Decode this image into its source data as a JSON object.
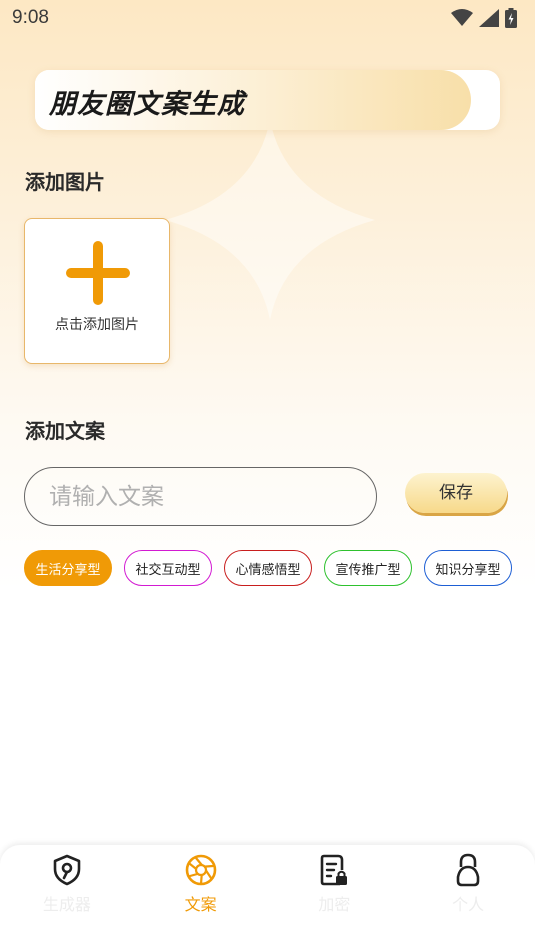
{
  "status_bar": {
    "time": "9:08"
  },
  "header": {
    "title": "朋友圈文案生成"
  },
  "image_section": {
    "title": "添加图片",
    "add_label": "点击添加图片"
  },
  "copy_section": {
    "title": "添加文案",
    "input_placeholder": "请输入文案",
    "input_value": "",
    "save_label": "保存"
  },
  "tags": [
    {
      "label": "生活分享型",
      "active": true,
      "color": "#f09a06"
    },
    {
      "label": "社交互动型",
      "active": false,
      "color": "#d21ad2"
    },
    {
      "label": "心情感悟型",
      "active": false,
      "color": "#c81e1e"
    },
    {
      "label": "宣传推广型",
      "active": false,
      "color": "#2ec12e"
    },
    {
      "label": "知识分享型",
      "active": false,
      "color": "#1d5ed4"
    }
  ],
  "bottom_nav": [
    {
      "label": "生成器",
      "icon": "shield-icon",
      "active": false
    },
    {
      "label": "文案",
      "icon": "aperture-icon",
      "active": true
    },
    {
      "label": "加密",
      "icon": "locked-document-icon",
      "active": false
    },
    {
      "label": "个人",
      "icon": "person-lock-icon",
      "active": false
    }
  ],
  "colors": {
    "accent": "#f09a06",
    "nav_inactive": "#ededed"
  }
}
